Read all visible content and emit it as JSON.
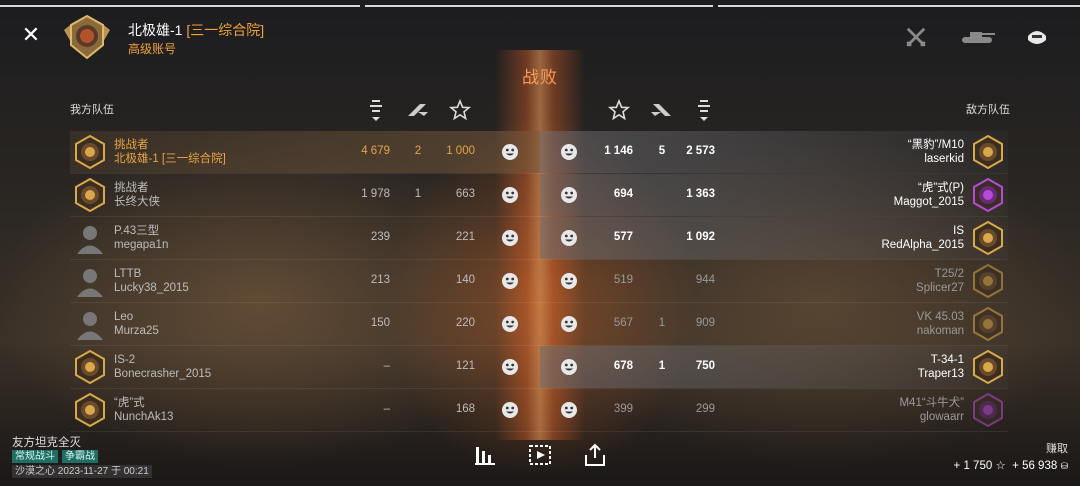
{
  "header": {
    "player_name": "北极雄-1",
    "player_clan": "[三一综合院]",
    "account_type": "高级账号",
    "result_title": "战败"
  },
  "top_icons": [
    "crossed-swords-icon",
    "tank-icon",
    "helmet-icon"
  ],
  "teams": {
    "ally_label": "我方队伍",
    "enemy_label": "敌方队伍"
  },
  "ally": [
    {
      "tank": "挑战者",
      "player": "北极雄-1 [三一综合院]",
      "damage": "4 679",
      "kills": "2",
      "xp": "1 000",
      "highlight": true,
      "self": true
    },
    {
      "tank": "挑战者",
      "player": "长终大侠",
      "damage": "1 978",
      "kills": "1",
      "xp": "663",
      "highlight": false
    },
    {
      "tank": "P.43三型",
      "player": "megapa1n",
      "damage": "239",
      "kills": "",
      "xp": "221",
      "highlight": false
    },
    {
      "tank": "LTTB",
      "player": "Lucky38_2015",
      "damage": "213",
      "kills": "",
      "xp": "140",
      "highlight": false
    },
    {
      "tank": "Leo",
      "player": "Murza25",
      "damage": "150",
      "kills": "",
      "xp": "220",
      "highlight": false
    },
    {
      "tank": "IS-2",
      "player": "Bonecrasher_2015",
      "damage": "–",
      "kills": "",
      "xp": "121",
      "highlight": false
    },
    {
      "tank": "“虎”式",
      "player": "NunchAk13",
      "damage": "–",
      "kills": "",
      "xp": "168",
      "highlight": false
    }
  ],
  "enemy": [
    {
      "tank": "“黑豹”/M10",
      "player": "laserkid",
      "xp": "1 146",
      "kills": "5",
      "damage": "2 573",
      "alive": true
    },
    {
      "tank": "“虎”式(P)",
      "player": "Maggot_2015",
      "xp": "694",
      "kills": "",
      "damage": "1 363",
      "alive": true
    },
    {
      "tank": "IS",
      "player": "RedAlpha_2015",
      "xp": "577",
      "kills": "",
      "damage": "1 092",
      "alive": true
    },
    {
      "tank": "T25/2",
      "player": "Splicer27",
      "xp": "519",
      "kills": "",
      "damage": "944",
      "alive": false
    },
    {
      "tank": "VK 45.03",
      "player": "nakoman",
      "xp": "567",
      "kills": "1",
      "damage": "909",
      "alive": false
    },
    {
      "tank": "T-34-1",
      "player": "Traper13",
      "xp": "678",
      "kills": "1",
      "damage": "750",
      "alive": true
    },
    {
      "tank": "M41“斗牛犬”",
      "player": "glowaarr",
      "xp": "399",
      "kills": "",
      "damage": "299",
      "alive": false
    }
  ],
  "footer": {
    "result_reason": "友方坦克全灭",
    "mode_tag": "常规战斗",
    "type_tag": "争霸战",
    "map_date": "沙漠之心   2023-11-27 于 00:21",
    "earn_label": "赚取",
    "xp_earned": "+ 1 750",
    "credits_earned": "+ 56 938"
  },
  "colors": {
    "accent": "#e7a545",
    "title": "#ff9a55",
    "tag": "#1f6e66"
  }
}
